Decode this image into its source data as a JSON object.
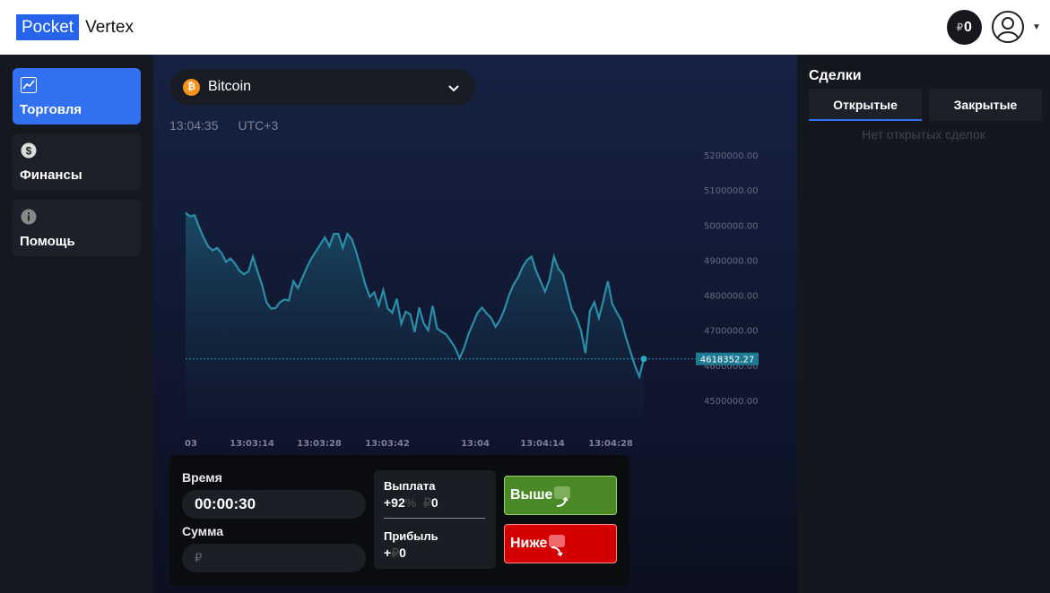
{
  "header": {
    "logo_box": "Pocket",
    "logo_text": "Vertex",
    "balance_currency": "₽",
    "balance_value": "0"
  },
  "sidebar": {
    "items": [
      {
        "label": "Торговля",
        "icon": "chart-line-icon",
        "active": true
      },
      {
        "label": "Финансы",
        "icon": "dollar-icon",
        "active": false
      },
      {
        "label": "Помощь",
        "icon": "info-icon",
        "active": false
      }
    ]
  },
  "asset": {
    "name": "Bitcoin",
    "coin_symbol": "₿"
  },
  "clock": {
    "time": "13:04:35",
    "tz": "UTC+3"
  },
  "chart_data": {
    "type": "area",
    "y_ticks": [
      "5200000.00",
      "5100000.00",
      "5000000.00",
      "4900000.00",
      "4800000.00",
      "4700000.00",
      "4600000.00",
      "4500000.00"
    ],
    "x_ticks": [
      "03",
      "13:03:14",
      "13:03:28",
      "13:03:42",
      "13:04",
      "13:04:14",
      "13:04:28"
    ],
    "current_price_label": "4618352.27",
    "current_price": 4618352.27,
    "ylim": [
      4500000,
      5200000
    ],
    "values": [
      5035000,
      5025000,
      5028000,
      4995000,
      4965000,
      4940000,
      4928000,
      4935000,
      4920000,
      4895000,
      4905000,
      4890000,
      4870000,
      4860000,
      4868000,
      4910000,
      4868000,
      4830000,
      4780000,
      4762000,
      4763000,
      4780000,
      4788000,
      4785000,
      4840000,
      4820000,
      4850000,
      4880000,
      4905000,
      4925000,
      4945000,
      4965000,
      4940000,
      4975000,
      4975000,
      4935000,
      4975000,
      4960000,
      4922000,
      4878000,
      4830000,
      4795000,
      4808000,
      4770000,
      4815000,
      4762000,
      4750000,
      4790000,
      4718000,
      4753000,
      4746000,
      4695000,
      4765000,
      4720000,
      4700000,
      4770000,
      4705000,
      4696000,
      4688000,
      4670000,
      4650000,
      4620000,
      4650000,
      4690000,
      4720000,
      4750000,
      4765000,
      4748000,
      4735000,
      4710000,
      4730000,
      4760000,
      4800000,
      4830000,
      4850000,
      4880000,
      4900000,
      4910000,
      4870000,
      4840000,
      4810000,
      4845000,
      4910000,
      4875000,
      4860000,
      4810000,
      4760000,
      4735000,
      4700000,
      4635000,
      4755000,
      4780000,
      4735000,
      4785000,
      4840000,
      4775000,
      4750000,
      4728000,
      4680000,
      4640000,
      4600000,
      4568000,
      4618352
    ]
  },
  "trade": {
    "time_label": "Время",
    "time_value": "00:00:30",
    "sum_label": "Сумма",
    "sum_placeholder": "₽",
    "payout_label": "Выплата",
    "payout_value": "+92",
    "payout_percent": "%",
    "payout_currency": "₽",
    "payout_amount": "0",
    "profit_label": "Прибыль",
    "profit_plus": "+",
    "profit_currency": "₽",
    "profit_amount": "0",
    "up_label": "Выше",
    "down_label": "Ниже"
  },
  "deals": {
    "title": "Сделки",
    "tabs": [
      "Открытые",
      "Закрытые"
    ],
    "empty": "Нет открытых сделок"
  },
  "colors": {
    "accent": "#3170f0",
    "up": "#4a8a26",
    "down": "#d40000",
    "chart_line": "#2a8ea8",
    "price_tag": "#1e7a93"
  }
}
